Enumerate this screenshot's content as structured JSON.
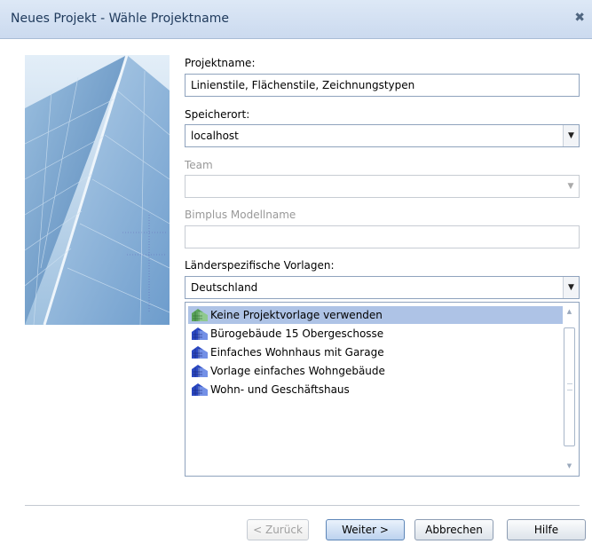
{
  "window": {
    "title": "Neues Projekt - Wähle Projektname",
    "close_glyph": "✖"
  },
  "form": {
    "projektname_label": "Projektname:",
    "projektname_value": "Linienstile, Flächenstile, Zeichnungstypen",
    "speicherort_label": "Speicherort:",
    "speicherort_value": "localhost",
    "team_label": "Team",
    "team_value": "",
    "bimplus_label": "Bimplus Modellname",
    "bimplus_value": "",
    "vorlagen_label": "Länderspezifische Vorlagen:",
    "vorlagen_value": "Deutschland"
  },
  "templates": [
    {
      "label": "Keine Projektvorlage verwenden",
      "selected": true,
      "icon": "green-building-icon"
    },
    {
      "label": "Bürogebäude 15 Obergeschosse",
      "selected": false,
      "icon": "blue-building-icon"
    },
    {
      "label": "Einfaches Wohnhaus mit Garage",
      "selected": false,
      "icon": "blue-building-icon"
    },
    {
      "label": "Vorlage einfaches Wohngebäude",
      "selected": false,
      "icon": "blue-building-icon"
    },
    {
      "label": "Wohn- und Geschäftshaus",
      "selected": false,
      "icon": "blue-building-icon"
    }
  ],
  "buttons": {
    "back": "< Zurück",
    "next": "Weiter >",
    "cancel": "Abbrechen",
    "help": "Hilfe"
  },
  "colors": {
    "selection": "#aec3e6",
    "title_text": "#1e395b"
  }
}
